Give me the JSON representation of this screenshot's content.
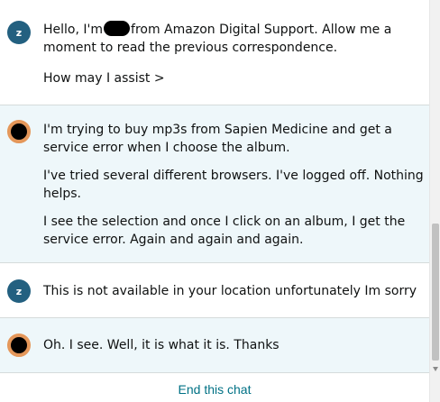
{
  "messages": [
    {
      "sender": "agent",
      "avatar_letter": "z",
      "text_before_redaction": "Hello, I'm",
      "text_after_redaction": "from Amazon Digital Support. Allow me a",
      "line2": "moment to read the previous correspondence.",
      "line3": "How may I assist >"
    },
    {
      "sender": "user",
      "p1_line1": "I'm trying to buy mp3s from Sapien Medicine and get a",
      "p1_line2": "service error when I choose the album.",
      "p2_line1": "I've tried several different browsers. I've logged off. Nothing",
      "p2_line2": "helps.",
      "p3_line1": "I see the selection and once I click on an album, I get the",
      "p3_line2": "service error. Again and again and again."
    },
    {
      "sender": "agent",
      "avatar_letter": "z",
      "text": "This is not available in your location unfortunately Im sorry"
    },
    {
      "sender": "user",
      "text": "Oh. I see. Well, it is what it is. Thanks"
    }
  ],
  "footer": {
    "end_chat_label": "End this chat"
  },
  "colors": {
    "agent_avatar": "#236080",
    "user_avatar_ring": "#e4975a",
    "user_bubble_bg": "#eef7fa",
    "link": "#007185",
    "text": "#0f1111"
  }
}
